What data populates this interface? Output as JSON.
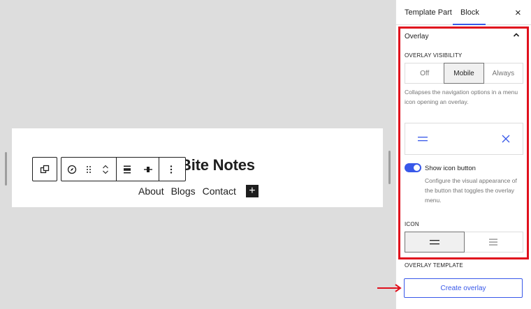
{
  "site": {
    "title": "Bite Notes",
    "nav_items": [
      "About",
      "Blogs",
      "Contact"
    ],
    "add_icon": "+"
  },
  "sidebar": {
    "tabs": [
      "Template Part",
      "Block"
    ],
    "active_tab": "Block",
    "close_icon": "×",
    "panel_title": "Overlay",
    "overlay_visibility_label": "OVERLAY VISIBILITY",
    "overlay_visibility_options": [
      "Off",
      "Mobile",
      "Always"
    ],
    "overlay_visibility_selected": "Mobile",
    "visibility_help": "Collapses the navigation options in a menu icon opening an overlay.",
    "show_icon_label": "Show icon button",
    "show_icon_enabled": true,
    "show_icon_help": "Configure the visual appearance of the button that toggles the overlay menu.",
    "icon_label": "ICON",
    "icon_options": [
      "two-line-menu-icon",
      "three-line-menu-icon"
    ],
    "icon_selected": "two-line-menu-icon",
    "overlay_template_label": "OVERLAY TEMPLATE",
    "create_overlay_label": "Create overlay"
  },
  "colors": {
    "accent": "#3858e9",
    "highlight": "#e0101d",
    "arrow": "#e0101d"
  }
}
